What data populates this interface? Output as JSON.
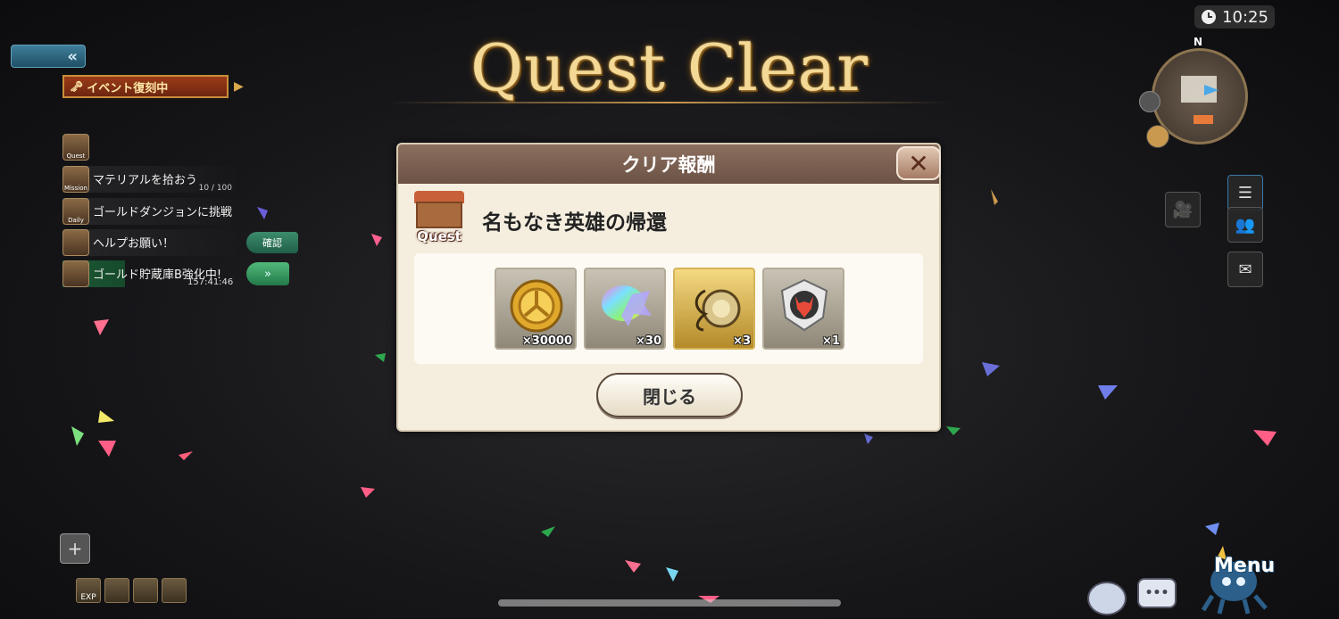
{
  "hud": {
    "clock": "10:25",
    "compass_north": "N",
    "menu_label": "Menu"
  },
  "left_panel": {
    "event_banner": "イベント復刻中",
    "quest_icon_label": "Quest",
    "mission": {
      "icon_label": "Mission",
      "title": "マテリアルを拾おう",
      "progress": "10 / 100"
    },
    "daily": {
      "icon_label": "Daily",
      "title": "ゴールドダンジョンに挑戦"
    },
    "help": {
      "title": "ヘルプお願い！",
      "button": "確認"
    },
    "gold": {
      "title": "ゴールド貯蔵庫B強化中!",
      "timer": "157:41:46"
    }
  },
  "quest_clear": {
    "title": "Quest Clear"
  },
  "dialog": {
    "header": "クリア報酬",
    "quest_badge": "Quest",
    "quest_name": "名もなき英雄の帰還",
    "rewards": [
      {
        "icon": "gold-coin-icon",
        "qty": "×30000"
      },
      {
        "icon": "rainbow-crystal-icon",
        "qty": "×30"
      },
      {
        "icon": "gold-orb-icon",
        "qty": "×3"
      },
      {
        "icon": "devil-emblem-icon",
        "qty": "×1"
      }
    ],
    "close_button": "閉じる"
  },
  "bottom_left": {
    "exp_label": "EXP"
  }
}
